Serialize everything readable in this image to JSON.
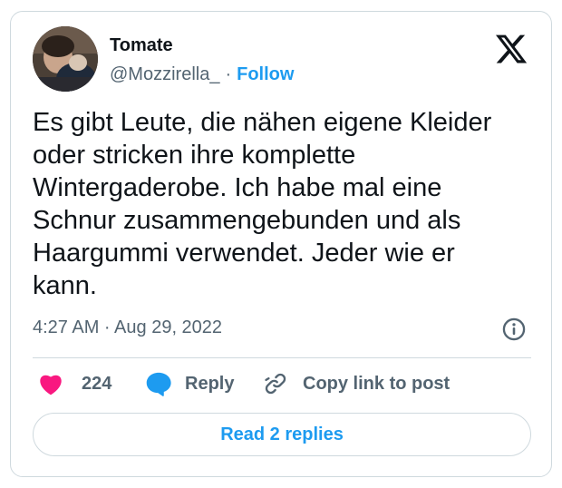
{
  "author": {
    "name": "Tomate",
    "handle": "@Mozzirella_",
    "separator": "·",
    "follow_label": "Follow"
  },
  "brand": {
    "logo_icon": "x-logo-icon"
  },
  "tweet": {
    "text": "Es gibt Leute, die nähen eigene Kleider\noder stricken ihre komplette\nWintergaderobe. Ich habe mal eine\nSchnur zusammengebunden und als\nHaargummi verwendet. Jeder wie er\nkann.",
    "timestamp": "4:27 AM · Aug 29, 2022"
  },
  "actions": {
    "like_count": "224",
    "reply_label": "Reply",
    "copy_label": "Copy link to post"
  },
  "read_replies_label": "Read 2 replies",
  "colors": {
    "accent": "#1d9bf0",
    "heart": "#f91880",
    "text_primary": "#0f1419",
    "text_secondary": "#536471",
    "border": "#cfd9de"
  }
}
